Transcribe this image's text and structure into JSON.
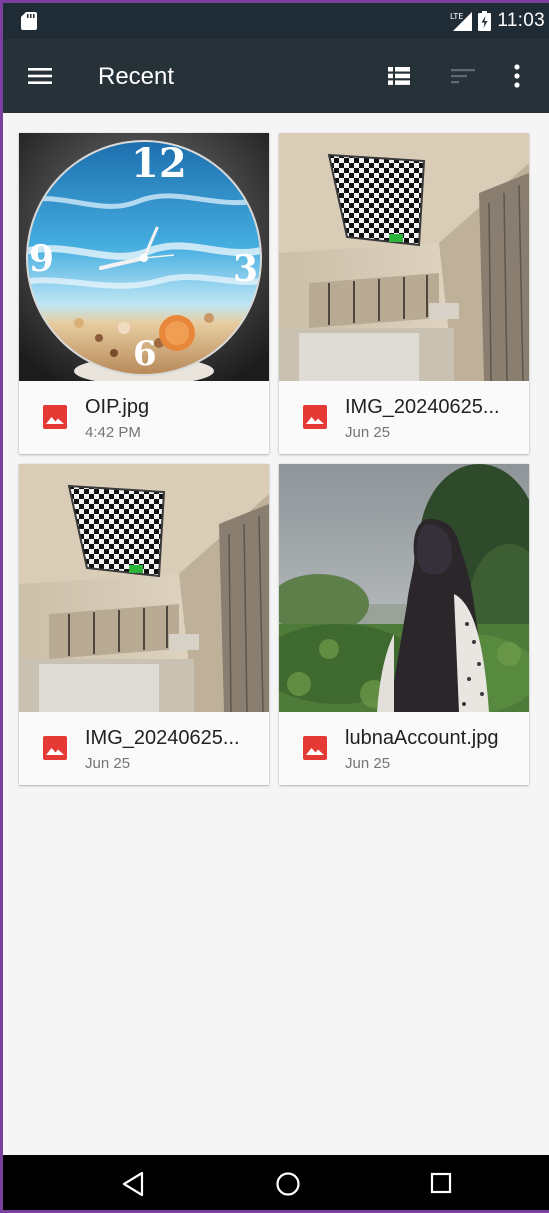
{
  "status_bar": {
    "time": "11:03",
    "network": "LTE"
  },
  "app_bar": {
    "title": "Recent"
  },
  "files": [
    {
      "name": "OIP.jpg",
      "date": "4:42 PM"
    },
    {
      "name": "IMG_20240625...",
      "date": "Jun 25"
    },
    {
      "name": "IMG_20240625...",
      "date": "Jun 25"
    },
    {
      "name": "lubnaAccount.jpg",
      "date": "Jun 25"
    }
  ],
  "colors": {
    "status_bar_bg": "#1f2b35",
    "app_bar_bg": "#263238",
    "image_file_icon": "#e53935",
    "background": "#f5f5f5"
  },
  "icons": {
    "menu": "hamburger-menu-icon",
    "list_view": "list-view-icon",
    "sort": "sort-icon",
    "more": "more-vert-icon",
    "file_type": "image-file-icon",
    "nav_back": "back-triangle-icon",
    "nav_home": "home-circle-icon",
    "nav_recents": "recents-square-icon"
  }
}
